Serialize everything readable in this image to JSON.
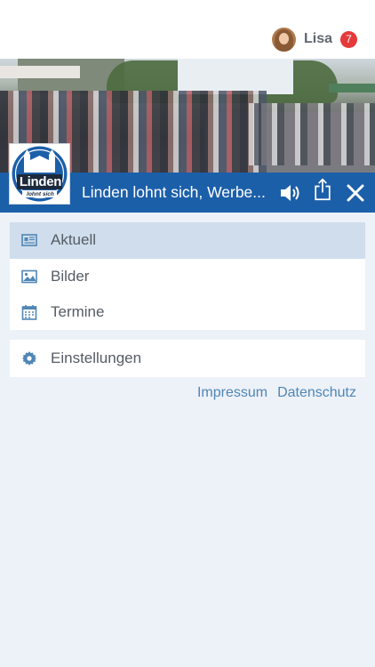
{
  "user": {
    "name": "Lisa",
    "notification_count": "7"
  },
  "header": {
    "title": "Linden lohnt sich, Werbe...",
    "logo_text": "Linden",
    "logo_subtext": "lohnt sich"
  },
  "menu": {
    "main_items": [
      {
        "label": "Aktuell",
        "icon": "newspaper-icon",
        "active": true
      },
      {
        "label": "Bilder",
        "icon": "image-icon",
        "active": false
      },
      {
        "label": "Termine",
        "icon": "calendar-icon",
        "active": false
      }
    ],
    "settings_item": {
      "label": "Einstellungen",
      "icon": "gear-icon"
    }
  },
  "footer_links": {
    "impressum": "Impressum",
    "datenschutz": "Datenschutz"
  },
  "colors": {
    "brand_blue": "#1c5fa9",
    "active_row": "#cfddec",
    "badge_red": "#e53a3a",
    "link_blue": "#4f86b5",
    "background": "#edf1f8"
  }
}
